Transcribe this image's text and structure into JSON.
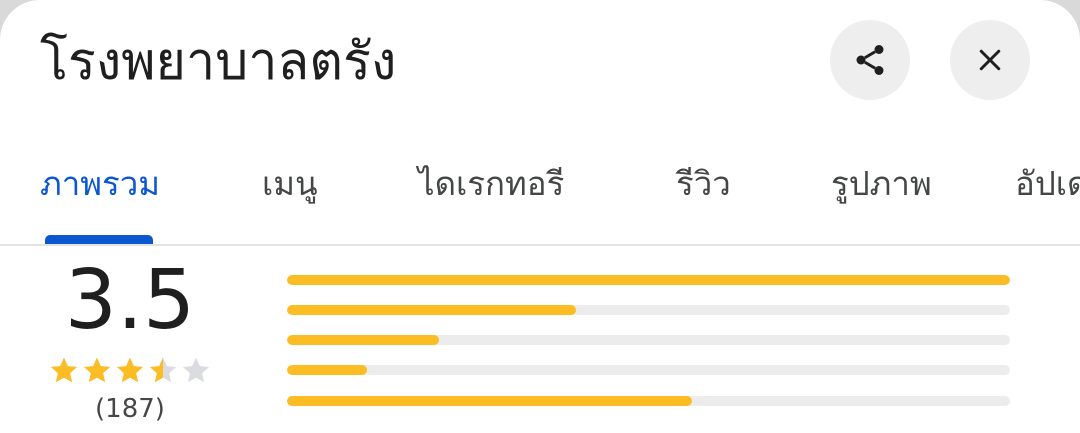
{
  "header": {
    "title": "โรงพยาบาลตรัง",
    "share_icon": "share-icon",
    "close_icon": "close-icon"
  },
  "tabs": [
    {
      "label": "ภาพรวม",
      "active": true
    },
    {
      "label": "เมนู",
      "active": false
    },
    {
      "label": "ไดเรกทอรี",
      "active": false
    },
    {
      "label": "รีวิว",
      "active": false
    },
    {
      "label": "รูปภาพ",
      "active": false
    },
    {
      "label": "อัปเด",
      "active": false
    }
  ],
  "rating": {
    "value": "3.5",
    "stars": 3.5,
    "max_stars": 5,
    "count": "(187)",
    "distribution": [
      {
        "stars": 5,
        "fraction": 1.0
      },
      {
        "stars": 4,
        "fraction": 0.4
      },
      {
        "stars": 3,
        "fraction": 0.21
      },
      {
        "stars": 2,
        "fraction": 0.11
      },
      {
        "stars": 1,
        "fraction": 0.56
      }
    ]
  },
  "colors": {
    "accent": "#0b57d0",
    "star": "#fbbc24",
    "star_empty": "#dadce0",
    "track": "#ececec"
  }
}
